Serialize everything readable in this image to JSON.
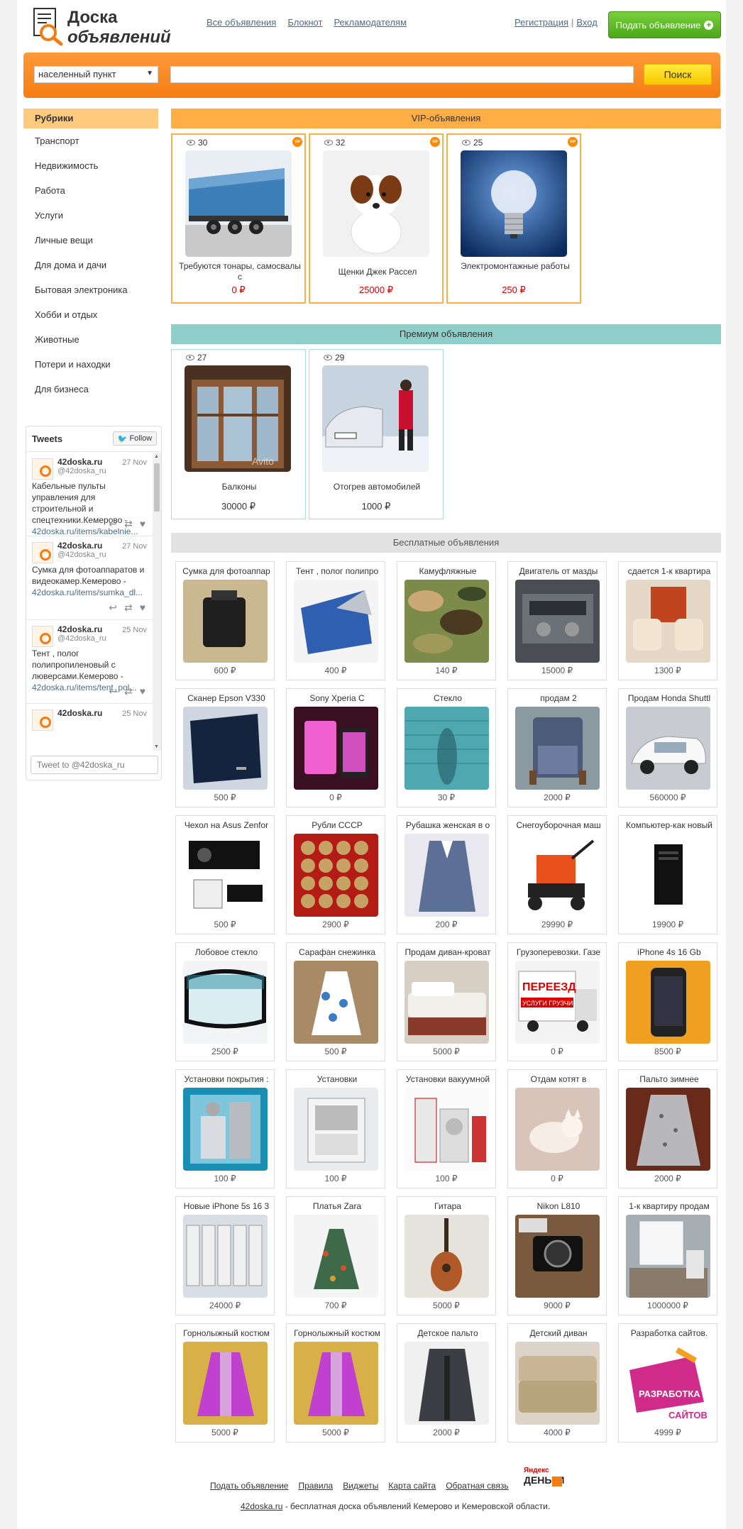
{
  "header": {
    "logo_line1": "Доска",
    "logo_line2": "объявлений",
    "nav": [
      "Все объявления",
      "Блокнот",
      "Рекламодателям"
    ],
    "register": "Регистрация",
    "login": "Вход",
    "separator": "|",
    "post_button": "Подать объявление",
    "post_icon": "plus-circle-icon",
    "accent": "#f57c12",
    "button_color": "#5cb82a"
  },
  "search": {
    "city_select": "населенный пункт",
    "query_value": "",
    "button": "Поиск"
  },
  "sidebar": {
    "heading": "Рубрики",
    "items": [
      "Транспорт",
      "Недвижимость",
      "Работа",
      "Услуги",
      "Личные вещи",
      "Для дома и дачи",
      "Бытовая электроника",
      "Хобби и отдых",
      "Животные",
      "Потери и находки",
      "Для бизнеса"
    ]
  },
  "tweets": {
    "title": "Tweets",
    "follow": "Follow",
    "compose_placeholder": "Tweet to @42doska_ru",
    "items": [
      {
        "name": "42doska.ru",
        "handle": "@42doska_ru",
        "date": "27 Nov",
        "text": "Кабельные пульты управления для строительной и спецтехники.Кемерово -",
        "link": "42doska.ru/items/kabelnie..."
      },
      {
        "name": "42doska.ru",
        "handle": "@42doska_ru",
        "date": "27 Nov",
        "text": "Сумка для фотоаппаратов и видеокамер.Кемерово -",
        "link": "42doska.ru/items/sumka_dl..."
      },
      {
        "name": "42doska.ru",
        "handle": "@42doska_ru",
        "date": "25 Nov",
        "text": "Тент , полог полипропиленовый с люверсами.Кемерово -",
        "link": "42doska.ru/items/tent_pol..."
      },
      {
        "name": "42doska.ru",
        "handle": "@42doska_ru",
        "date": "25 Nov",
        "text": "",
        "link": ""
      }
    ]
  },
  "vip": {
    "heading": "VIP-объявления",
    "badge": "VIP",
    "items": [
      {
        "views": "30",
        "title": "Требуются тонары, самосвалы с",
        "price": "0 ₽"
      },
      {
        "views": "32",
        "title": "Щенки Джек Рассел",
        "price": "25000 ₽"
      },
      {
        "views": "25",
        "title": "Электромонтажные работы",
        "price": "250 ₽"
      }
    ]
  },
  "premium": {
    "heading": "Премиум объявления",
    "items": [
      {
        "views": "27",
        "title": "Балконы",
        "price": "30000 ₽"
      },
      {
        "views": "29",
        "title": "Отогрев автомобилей",
        "price": "1000 ₽"
      }
    ]
  },
  "free": {
    "heading": "Бесплатные объявления",
    "items": [
      {
        "title": "Сумка для фотоаппар",
        "price": "600 ₽"
      },
      {
        "title": "Тент , полог полипро",
        "price": "400 ₽"
      },
      {
        "title": "Камуфляжные",
        "price": "140 ₽"
      },
      {
        "title": "Двигатель от мазды",
        "price": "15000 ₽"
      },
      {
        "title": "сдается 1-к квартира",
        "price": "1300 ₽"
      },
      {
        "title": "Сканер Epson V330",
        "price": "500 ₽"
      },
      {
        "title": "Sony Xperia C",
        "price": "0 ₽"
      },
      {
        "title": "Стекло",
        "price": "30 ₽"
      },
      {
        "title": "продам 2",
        "price": "2000 ₽"
      },
      {
        "title": "Продам Honda Shuttl",
        "price": "560000 ₽"
      },
      {
        "title": "Чехол на Asus Zenfor",
        "price": "500 ₽"
      },
      {
        "title": "Рубли СССР",
        "price": "2900 ₽"
      },
      {
        "title": "Рубашка женская в о",
        "price": "200 ₽"
      },
      {
        "title": "Снегоуборочная маш",
        "price": "29990 ₽"
      },
      {
        "title": "Компьютер-как новый",
        "price": "19900 ₽"
      },
      {
        "title": "Лобовое стекло",
        "price": "2500 ₽"
      },
      {
        "title": "Сарафан снежинка",
        "price": "500 ₽"
      },
      {
        "title": "Продам диван-кроват",
        "price": "5000 ₽"
      },
      {
        "title": "Грузоперевозки. Газе",
        "price": "0 ₽"
      },
      {
        "title": "iPhone 4s 16 Gb",
        "price": "8500 ₽"
      },
      {
        "title": "Установки покрытия :",
        "price": "100 ₽"
      },
      {
        "title": "Установки",
        "price": "100 ₽"
      },
      {
        "title": "Установки вакуумной",
        "price": "100 ₽"
      },
      {
        "title": "Отдам котят в",
        "price": "0 ₽"
      },
      {
        "title": "Пальто зимнее",
        "price": "2000 ₽"
      },
      {
        "title": "Новые iPhone 5s 16 3",
        "price": "24000 ₽"
      },
      {
        "title": "Платья Zara",
        "price": "700 ₽"
      },
      {
        "title": "Гитара",
        "price": "5000 ₽"
      },
      {
        "title": "Nikon L810",
        "price": "9000 ₽"
      },
      {
        "title": "1-к квартиру продам",
        "price": "1000000 ₽"
      },
      {
        "title": "Горнолыжный костюм",
        "price": "5000 ₽"
      },
      {
        "title": "Горнолыжный костюм",
        "price": "5000 ₽"
      },
      {
        "title": "Детское пальто",
        "price": "2000 ₽"
      },
      {
        "title": "Детский диван",
        "price": "4000 ₽"
      },
      {
        "title": "Разработка сайтов.",
        "price": "4999 ₽"
      }
    ]
  },
  "image_texts": {
    "watermark": "Avito",
    "moving_line1": "ПЕРЕЕЗД",
    "moving_line2": "УСЛУГИ ГРУЗЧИ",
    "web_line1": "РАЗРАБОТКА",
    "web_line2": "САЙТОВ"
  },
  "footer": {
    "links": [
      "Подать объявление",
      "Правила",
      "Виджеты",
      "Карта сайта",
      "Обратная связь"
    ],
    "ym_line1": "Яндекс",
    "ym_line2": "ДЕНЬГИ",
    "site": "42doska.ru",
    "tagline": " - бесплатная доска объявлений Кемерово и Кемеровской области."
  }
}
